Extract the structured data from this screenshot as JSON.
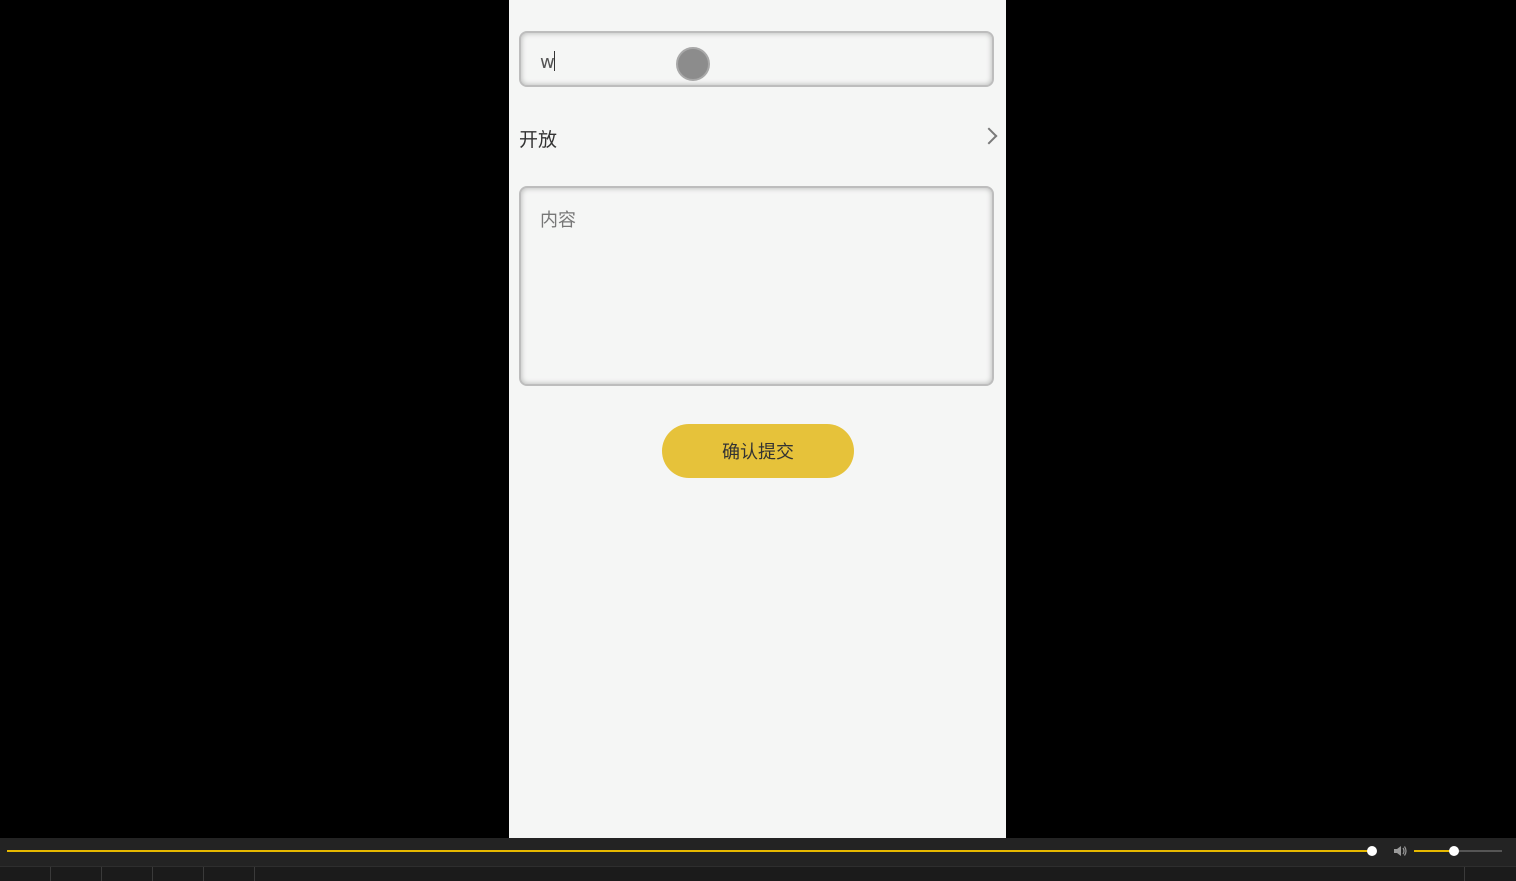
{
  "form": {
    "title_value": "w",
    "visibility_label": "开放",
    "content_placeholder": "内容",
    "submit_label": "确认提交"
  },
  "player": {
    "progress": 1.0,
    "volume": 0.45
  },
  "colors": {
    "accent": "#e6c23a",
    "progress": "#e6b800",
    "page_background": "#f5f6f5"
  },
  "icons": [
    "chevron-right-icon",
    "volume-icon"
  ]
}
